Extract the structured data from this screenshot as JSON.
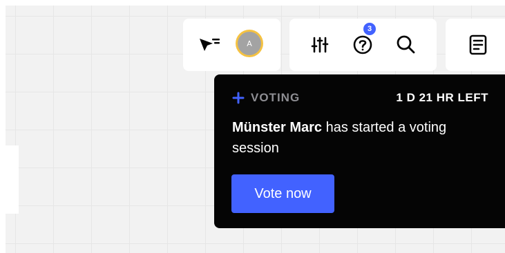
{
  "toolbar": {
    "avatar_initial": "A",
    "notifications_count": "3"
  },
  "icons": {
    "cursor": "cursor-filter-icon",
    "settings": "sliders-icon",
    "help": "question-circle-icon",
    "search": "search-icon",
    "notes": "document-icon",
    "plus": "plus-icon"
  },
  "voting_popover": {
    "label": "VOTING",
    "time_left": "1 D 21 HR LEFT",
    "user_name": "Münster Marc",
    "message_rest": " has started a voting session",
    "button_label": "Vote now"
  },
  "colors": {
    "accent": "#4262ff",
    "popover_bg": "#050505",
    "avatar_ring": "#f5c242",
    "label_gray": "#8e8e93"
  }
}
